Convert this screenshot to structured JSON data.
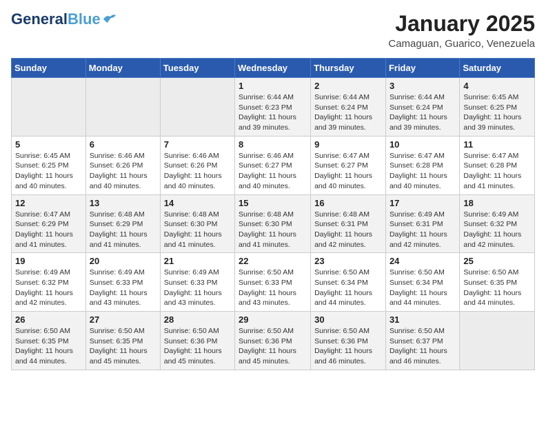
{
  "header": {
    "logo_line1": "General",
    "logo_line2": "Blue",
    "month": "January 2025",
    "location": "Camaguan, Guarico, Venezuela"
  },
  "weekdays": [
    "Sunday",
    "Monday",
    "Tuesday",
    "Wednesday",
    "Thursday",
    "Friday",
    "Saturday"
  ],
  "weeks": [
    [
      {
        "day": "",
        "info": ""
      },
      {
        "day": "",
        "info": ""
      },
      {
        "day": "",
        "info": ""
      },
      {
        "day": "1",
        "info": "Sunrise: 6:44 AM\nSunset: 6:23 PM\nDaylight: 11 hours and 39 minutes."
      },
      {
        "day": "2",
        "info": "Sunrise: 6:44 AM\nSunset: 6:24 PM\nDaylight: 11 hours and 39 minutes."
      },
      {
        "day": "3",
        "info": "Sunrise: 6:44 AM\nSunset: 6:24 PM\nDaylight: 11 hours and 39 minutes."
      },
      {
        "day": "4",
        "info": "Sunrise: 6:45 AM\nSunset: 6:25 PM\nDaylight: 11 hours and 39 minutes."
      }
    ],
    [
      {
        "day": "5",
        "info": "Sunrise: 6:45 AM\nSunset: 6:25 PM\nDaylight: 11 hours and 40 minutes."
      },
      {
        "day": "6",
        "info": "Sunrise: 6:46 AM\nSunset: 6:26 PM\nDaylight: 11 hours and 40 minutes."
      },
      {
        "day": "7",
        "info": "Sunrise: 6:46 AM\nSunset: 6:26 PM\nDaylight: 11 hours and 40 minutes."
      },
      {
        "day": "8",
        "info": "Sunrise: 6:46 AM\nSunset: 6:27 PM\nDaylight: 11 hours and 40 minutes."
      },
      {
        "day": "9",
        "info": "Sunrise: 6:47 AM\nSunset: 6:27 PM\nDaylight: 11 hours and 40 minutes."
      },
      {
        "day": "10",
        "info": "Sunrise: 6:47 AM\nSunset: 6:28 PM\nDaylight: 11 hours and 40 minutes."
      },
      {
        "day": "11",
        "info": "Sunrise: 6:47 AM\nSunset: 6:28 PM\nDaylight: 11 hours and 41 minutes."
      }
    ],
    [
      {
        "day": "12",
        "info": "Sunrise: 6:47 AM\nSunset: 6:29 PM\nDaylight: 11 hours and 41 minutes."
      },
      {
        "day": "13",
        "info": "Sunrise: 6:48 AM\nSunset: 6:29 PM\nDaylight: 11 hours and 41 minutes."
      },
      {
        "day": "14",
        "info": "Sunrise: 6:48 AM\nSunset: 6:30 PM\nDaylight: 11 hours and 41 minutes."
      },
      {
        "day": "15",
        "info": "Sunrise: 6:48 AM\nSunset: 6:30 PM\nDaylight: 11 hours and 41 minutes."
      },
      {
        "day": "16",
        "info": "Sunrise: 6:48 AM\nSunset: 6:31 PM\nDaylight: 11 hours and 42 minutes."
      },
      {
        "day": "17",
        "info": "Sunrise: 6:49 AM\nSunset: 6:31 PM\nDaylight: 11 hours and 42 minutes."
      },
      {
        "day": "18",
        "info": "Sunrise: 6:49 AM\nSunset: 6:32 PM\nDaylight: 11 hours and 42 minutes."
      }
    ],
    [
      {
        "day": "19",
        "info": "Sunrise: 6:49 AM\nSunset: 6:32 PM\nDaylight: 11 hours and 42 minutes."
      },
      {
        "day": "20",
        "info": "Sunrise: 6:49 AM\nSunset: 6:33 PM\nDaylight: 11 hours and 43 minutes."
      },
      {
        "day": "21",
        "info": "Sunrise: 6:49 AM\nSunset: 6:33 PM\nDaylight: 11 hours and 43 minutes."
      },
      {
        "day": "22",
        "info": "Sunrise: 6:50 AM\nSunset: 6:33 PM\nDaylight: 11 hours and 43 minutes."
      },
      {
        "day": "23",
        "info": "Sunrise: 6:50 AM\nSunset: 6:34 PM\nDaylight: 11 hours and 44 minutes."
      },
      {
        "day": "24",
        "info": "Sunrise: 6:50 AM\nSunset: 6:34 PM\nDaylight: 11 hours and 44 minutes."
      },
      {
        "day": "25",
        "info": "Sunrise: 6:50 AM\nSunset: 6:35 PM\nDaylight: 11 hours and 44 minutes."
      }
    ],
    [
      {
        "day": "26",
        "info": "Sunrise: 6:50 AM\nSunset: 6:35 PM\nDaylight: 11 hours and 44 minutes."
      },
      {
        "day": "27",
        "info": "Sunrise: 6:50 AM\nSunset: 6:35 PM\nDaylight: 11 hours and 45 minutes."
      },
      {
        "day": "28",
        "info": "Sunrise: 6:50 AM\nSunset: 6:36 PM\nDaylight: 11 hours and 45 minutes."
      },
      {
        "day": "29",
        "info": "Sunrise: 6:50 AM\nSunset: 6:36 PM\nDaylight: 11 hours and 45 minutes."
      },
      {
        "day": "30",
        "info": "Sunrise: 6:50 AM\nSunset: 6:36 PM\nDaylight: 11 hours and 46 minutes."
      },
      {
        "day": "31",
        "info": "Sunrise: 6:50 AM\nSunset: 6:37 PM\nDaylight: 11 hours and 46 minutes."
      },
      {
        "day": "",
        "info": ""
      }
    ]
  ]
}
